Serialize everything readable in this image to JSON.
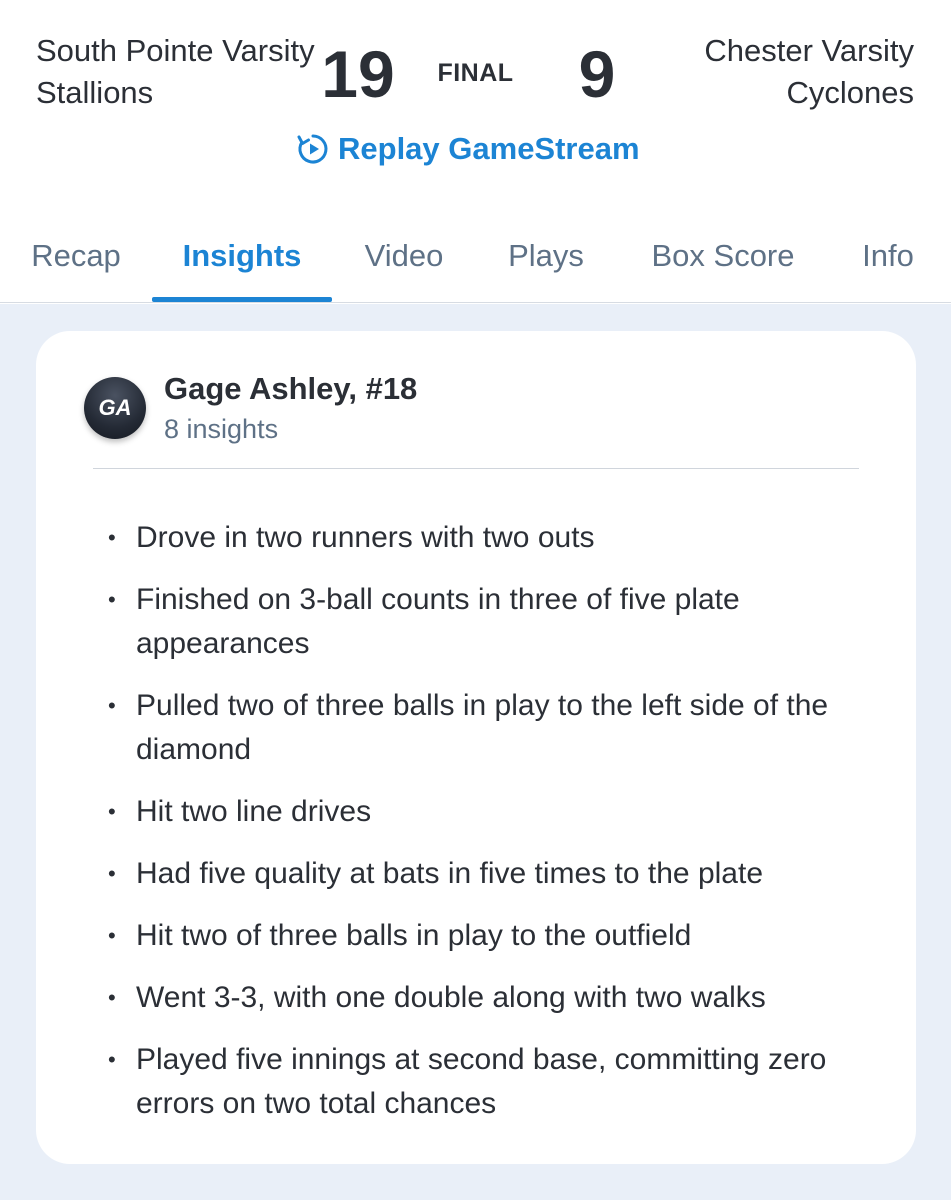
{
  "game": {
    "home_team": "South Pointe Varsity Stallions",
    "home_score": "19",
    "status": "FINAL",
    "away_score": "9",
    "away_team": "Chester Varsity Cyclones",
    "replay_label": "Replay GameStream"
  },
  "tabs": [
    {
      "label": "Recap",
      "active": false
    },
    {
      "label": "Insights",
      "active": true
    },
    {
      "label": "Video",
      "active": false
    },
    {
      "label": "Plays",
      "active": false
    },
    {
      "label": "Box Score",
      "active": false
    },
    {
      "label": "Info",
      "active": false
    }
  ],
  "player": {
    "initials": "GA",
    "name": "Gage Ashley, #18",
    "insight_count": "8 insights"
  },
  "insights": [
    "Drove in two runners with two outs",
    "Finished on 3-ball counts in three of five plate appearances",
    "Pulled two of three balls in play to the left side of the diamond",
    "Hit two line drives",
    "Had five quality at bats in five times to the plate",
    "Hit two of three balls in play to the outfield",
    "Went 3-3, with one double along with two walks",
    "Played five innings at second base, committing zero errors on two total chances"
  ],
  "colors": {
    "accent": "#1c84d4",
    "text": "#2b2f36",
    "muted": "#5e7186",
    "background": "#e9eff8"
  }
}
